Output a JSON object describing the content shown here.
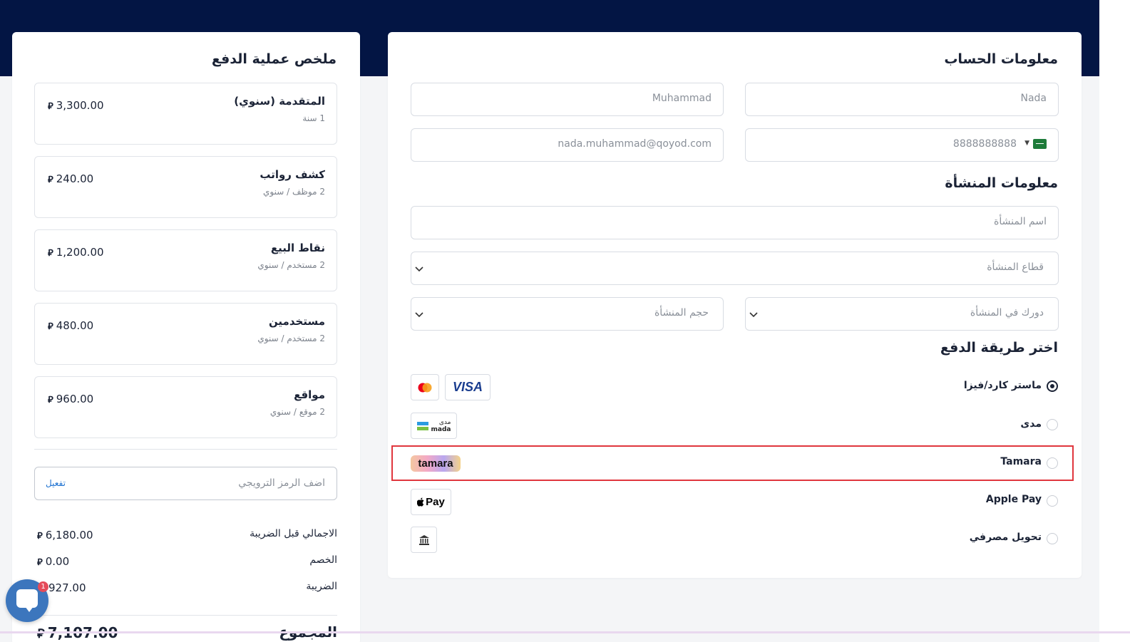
{
  "account": {
    "title": "معلومات الحساب",
    "first_name": "Nada",
    "last_name": "Muhammad",
    "phone": "8888888888",
    "email": "nada.muhammad@qoyod.com"
  },
  "organization": {
    "title": "معلومات المنشأة",
    "name_placeholder": "اسم المنشأة",
    "sector_placeholder": "قطاع المنشأة",
    "role_placeholder": "دورك في المنشأة",
    "size_placeholder": "حجم المنشأة"
  },
  "payment": {
    "title": "اختر طريقة الدفع",
    "methods": [
      {
        "label": "ماستر كارد/فيزا",
        "selected": true,
        "badges": [
          "mastercard-logo",
          "visa-logo"
        ]
      },
      {
        "label": "مدى",
        "selected": false,
        "badges": [
          "mada-logo"
        ]
      },
      {
        "label": "Tamara",
        "selected": false,
        "badges": [
          "tamara-logo"
        ]
      },
      {
        "label": "Apple Pay",
        "selected": false,
        "badges": [
          "apple-pay-logo"
        ]
      },
      {
        "label": "تحويل مصرفي",
        "selected": false,
        "badges": [
          "bank-icon"
        ]
      }
    ],
    "visa_text": "VISA",
    "mada_ar": "مدى",
    "mada_en": "mada",
    "tamara_text": "tamara",
    "applepay_text": "Pay"
  },
  "summary": {
    "title": "ملخص عملية الدفع",
    "currency_symbol": "⃁",
    "items": [
      {
        "name": "المتقدمة (سنوي)",
        "sub": "1 سنة",
        "price": "3,300.00"
      },
      {
        "name": "كشف رواتب",
        "sub": "2 موظف / سنوي",
        "price": "240.00"
      },
      {
        "name": "نقاط البيع",
        "sub": "2 مستخدم / سنوي",
        "price": "1,200.00"
      },
      {
        "name": "مستخدمين",
        "sub": "2 مستخدم / سنوي",
        "price": "480.00"
      },
      {
        "name": "مواقع",
        "sub": "2 موقع / سنوي",
        "price": "960.00"
      }
    ],
    "promo_placeholder": "اضف الرمز الترويجي",
    "promo_apply": "تفعيل",
    "subtotal_label": "الاجمالي قبل الضريبة",
    "subtotal_value": "6,180.00",
    "discount_label": "الخصم",
    "discount_value": "0.00",
    "tax_label": "الضريبة",
    "tax_value": "927.00",
    "total_label": "المجموع",
    "total_value": "7,107.00"
  },
  "chat": {
    "unread_count": "1"
  },
  "colors": {
    "navy": "#031544",
    "highlight": "#e0363d",
    "link": "#1a6fd0"
  }
}
